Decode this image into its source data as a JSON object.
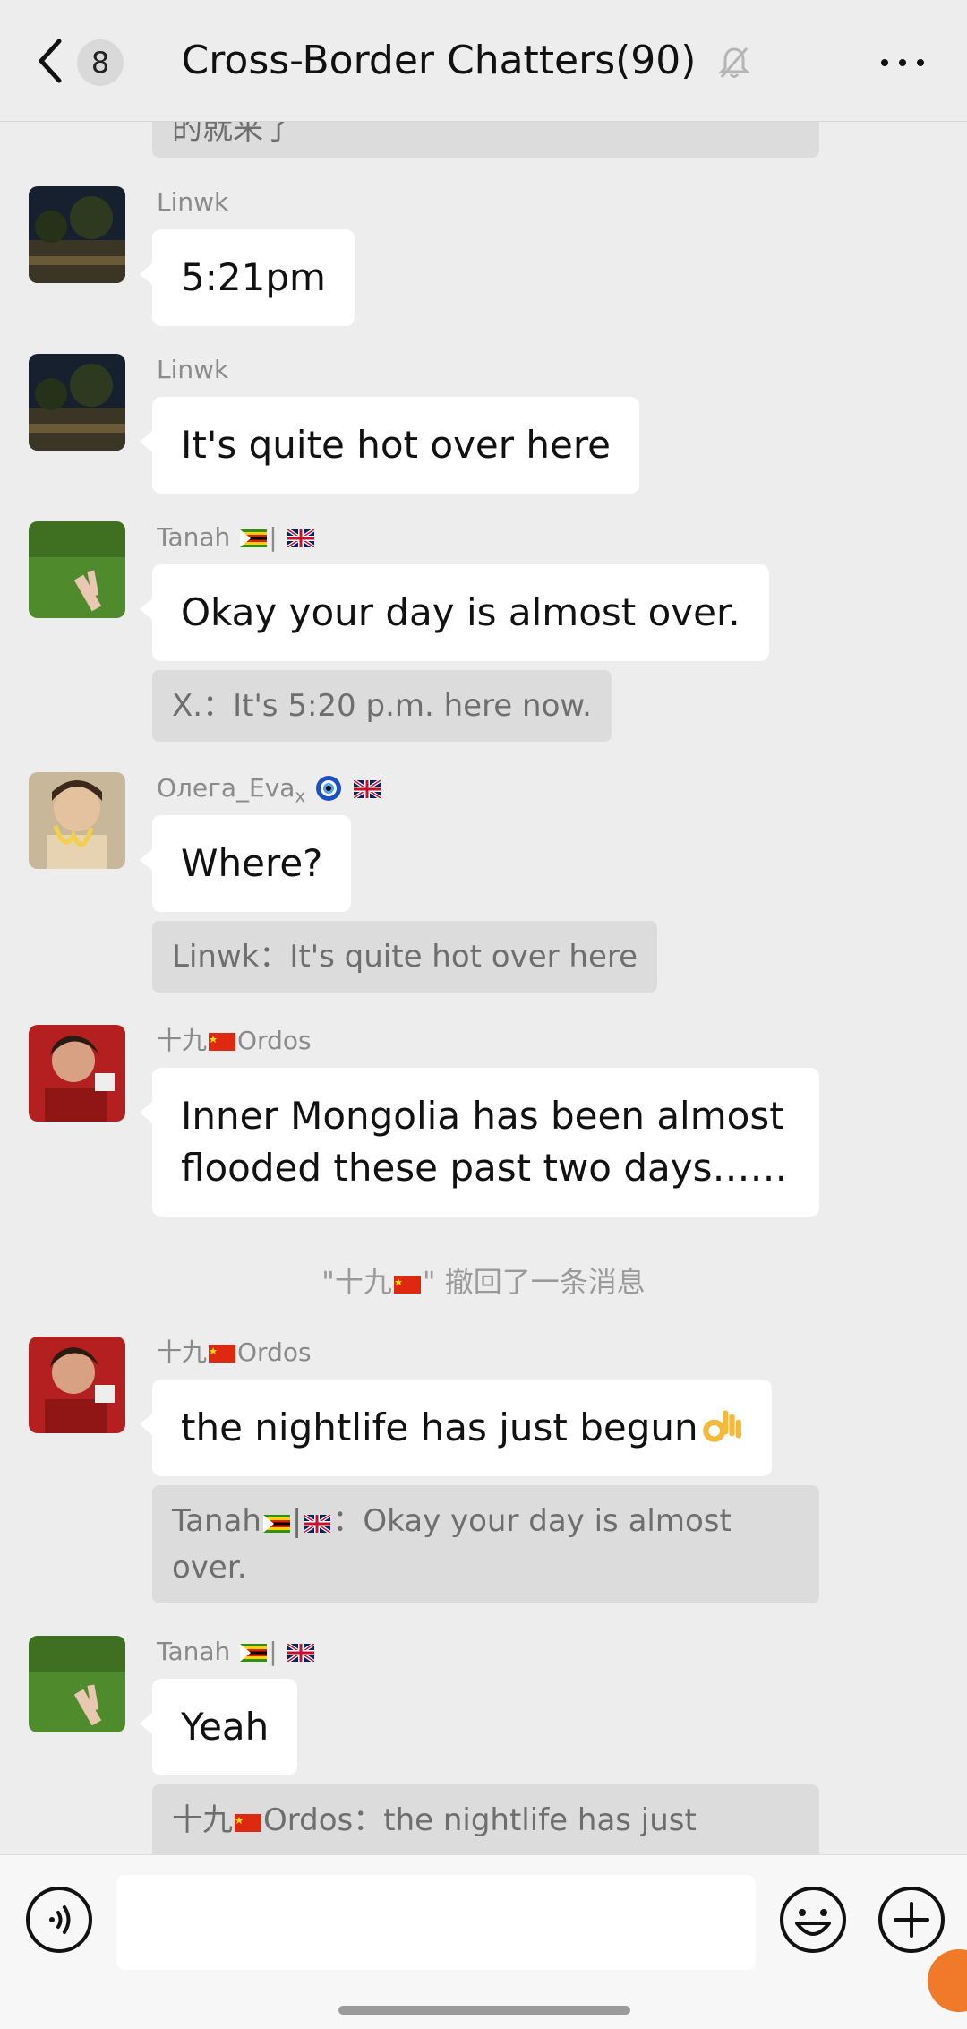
{
  "header": {
    "back_count": "8",
    "title": "Cross-Border Chatters(90)"
  },
  "top_fragment": "的就来了",
  "messages": [
    {
      "sender": "Linwk",
      "text": "5:21pm"
    },
    {
      "sender": "Linwk",
      "text": "It's quite hot over here"
    },
    {
      "sender_name": "Tanah",
      "sender_sep": "|",
      "text": "Okay your day is almost over.",
      "quote": "X.：It's 5:20 p.m. here now."
    },
    {
      "sender_name": "Олега_Eva",
      "sender_sub": "x",
      "text": "Where?",
      "quote": "Linwk：It's quite hot over here"
    },
    {
      "sender_prefix": "十九",
      "sender_name": "Ordos",
      "text_line1": "Inner Mongolia has been almost",
      "text_line2": "flooded these past two days……"
    },
    {
      "sender_prefix": "十九",
      "sender_name": "Ordos",
      "text": "the nightlife has just begun",
      "quote_name": "Tanah",
      "quote_sep": "|",
      "quote_line1": "：Okay your day is almost",
      "quote_line2": "over."
    },
    {
      "sender_name": "Tanah",
      "sender_sep": "|",
      "text": "Yeah",
      "quote_prefix": "十九",
      "quote_rest": "Ordos：the nightlife has just"
    }
  ],
  "system_notice": {
    "open_quote": "\"十九",
    "rest": "\" 撤回了一条消息"
  },
  "icons": {
    "back": "chevron-left-icon",
    "mute": "bell-off-icon",
    "more": "more-dots-icon",
    "voice": "voice-icon",
    "emoji": "emoji-icon",
    "plus": "plus-icon",
    "ok_emoji": "ok-hand-emoji"
  },
  "colors": {
    "background": "#ededed",
    "bubble": "#ffffff",
    "quote_bg": "#dcdcdc",
    "sender_text": "#8a8a8a"
  }
}
